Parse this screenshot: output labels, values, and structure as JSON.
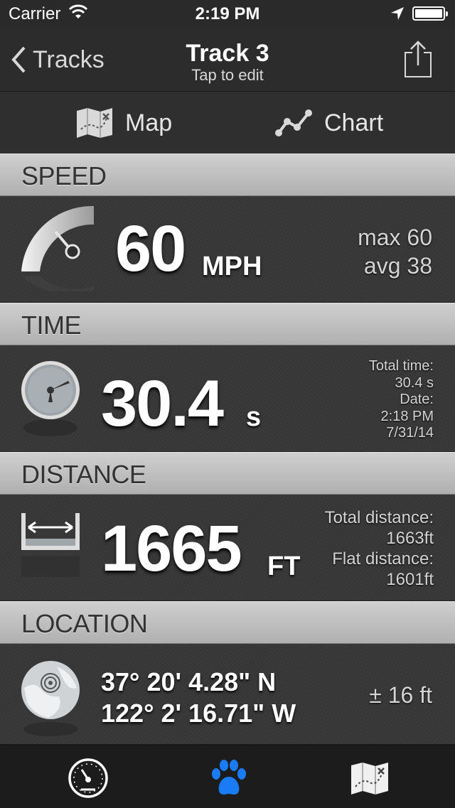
{
  "status_bar": {
    "carrier": "Carrier",
    "time": "2:19 PM"
  },
  "nav": {
    "back_label": "Tracks",
    "title": "Track 3",
    "subtitle": "Tap to edit"
  },
  "segments": {
    "map_label": "Map",
    "chart_label": "Chart"
  },
  "speed": {
    "header": "SPEED",
    "value": "60",
    "unit": "MPH",
    "max": "max 60",
    "avg": "avg 38"
  },
  "time": {
    "header": "TIME",
    "value": "30.4",
    "unit": "s",
    "total_time_label": "Total time:",
    "total_time_value": "30.4 s",
    "date_label": "Date:",
    "date_time": "2:18 PM",
    "date_value": "7/31/14"
  },
  "distance": {
    "header": "DISTANCE",
    "value": "1665",
    "unit": "FT",
    "total_label": "Total distance:",
    "total_value": "1663ft",
    "flat_label": "Flat distance:",
    "flat_value": "1601ft"
  },
  "location": {
    "header": "LOCATION",
    "latitude": "37° 20' 4.28\" N",
    "longitude": "122° 2' 16.71\" W",
    "accuracy": "± 16 ft"
  },
  "tabs": [
    {
      "icon": "speedometer-icon",
      "active": false
    },
    {
      "icon": "paw-icon",
      "active": true,
      "color": "#1a7cf5"
    },
    {
      "icon": "map-icon",
      "active": false
    }
  ]
}
